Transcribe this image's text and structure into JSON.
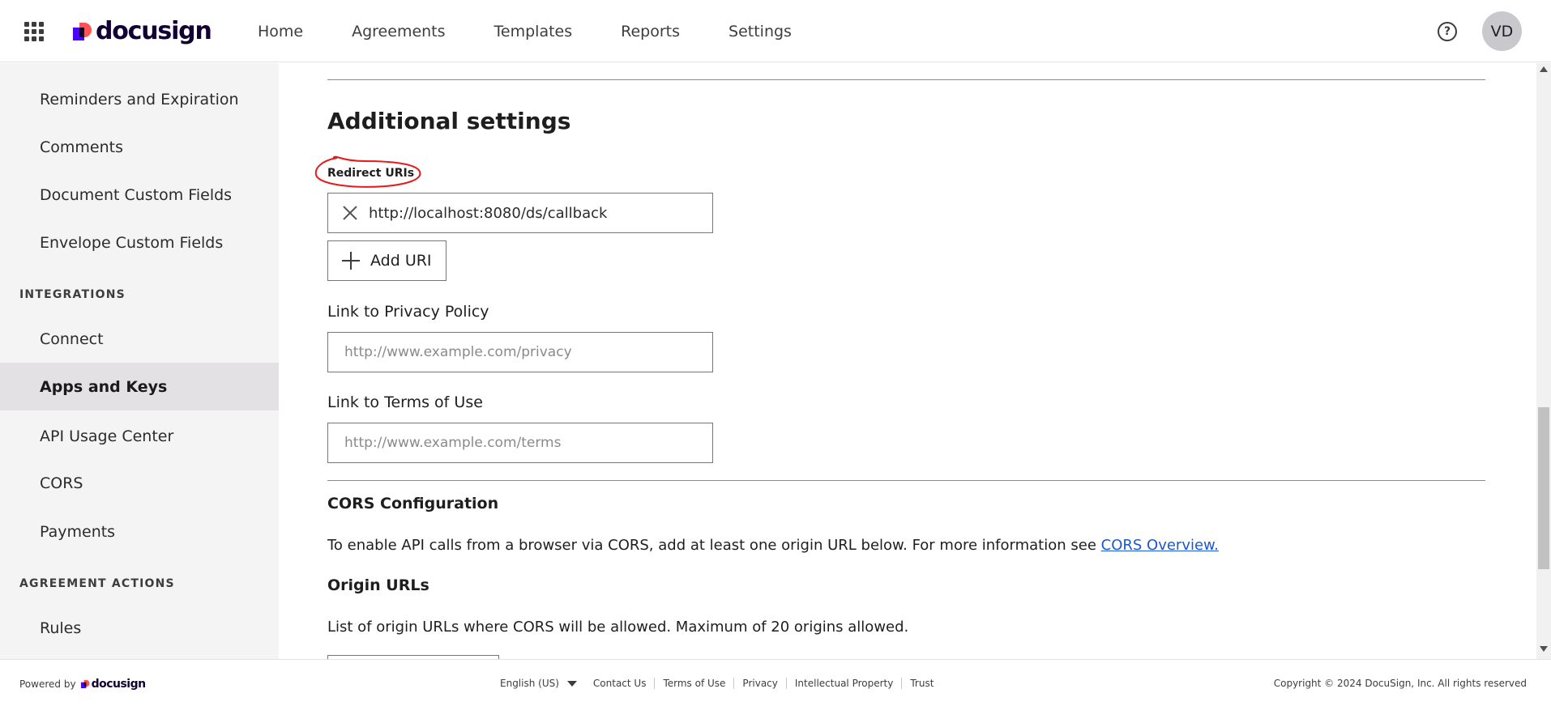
{
  "header": {
    "logo_text": "docusign",
    "nav": [
      "Home",
      "Agreements",
      "Templates",
      "Reports",
      "Settings"
    ],
    "help_icon": "question-circle-icon",
    "avatar_initials": "VD",
    "colors": {
      "brand_purple": "#4c00ff",
      "brand_red": "#ff5252",
      "brand_dark": "#130032"
    }
  },
  "sidebar": {
    "items_top": [
      "Reminders and Expiration",
      "Comments",
      "Document Custom Fields",
      "Envelope Custom Fields"
    ],
    "section_integrations": "INTEGRATIONS",
    "items_integrations": [
      "Connect",
      "Apps and Keys",
      "API Usage Center",
      "CORS",
      "Payments"
    ],
    "active_item": "Apps and Keys",
    "section_agreement_actions": "AGREEMENT ACTIONS",
    "items_agreement_actions": [
      "Rules"
    ]
  },
  "main": {
    "heading": "Additional settings",
    "redirect_label": "Redirect URIs",
    "redirect_uri_value": "http://localhost:8080/ds/callback",
    "add_uri_label": "Add URI",
    "privacy_label": "Link to Privacy Policy",
    "privacy_placeholder": "http://www.example.com/privacy",
    "terms_label": "Link to Terms of Use",
    "terms_placeholder": "http://www.example.com/terms",
    "cors_heading": "CORS Configuration",
    "cors_text": "To enable API calls from a browser via CORS, add at least one origin URL below. For more information see",
    "cors_link": "CORS Overview.",
    "origin_heading": "Origin URLs",
    "origin_text": "List of origin URLs where CORS will be allowed. Maximum of 20 origins allowed.",
    "link_color": "#1a57d5",
    "annotation_color": "#e41b1b"
  },
  "footer": {
    "powered_by": "Powered by",
    "logo_text": "docusign",
    "language": "English (US)",
    "links": [
      "Contact Us",
      "Terms of Use",
      "Privacy",
      "Intellectual Property",
      "Trust"
    ],
    "copyright": "Copyright © 2024 DocuSign, Inc. All rights reserved"
  }
}
